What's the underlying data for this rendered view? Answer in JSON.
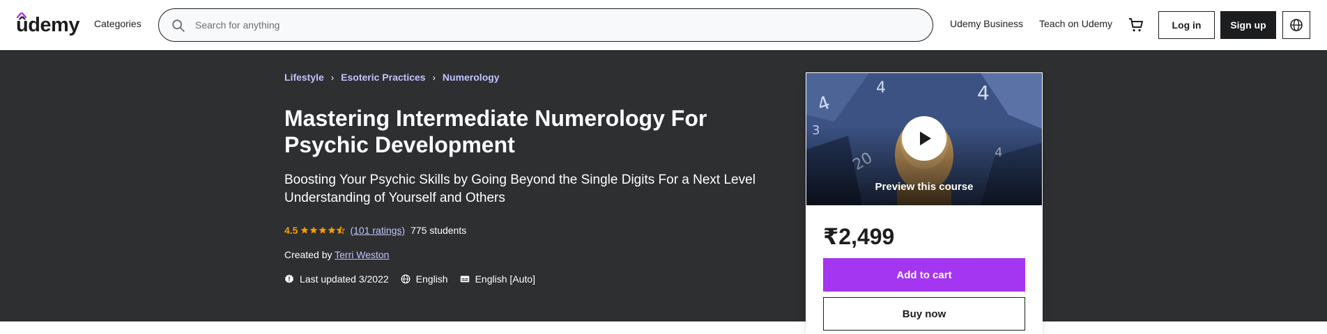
{
  "header": {
    "logo": "ûdemy",
    "categories_label": "Categories",
    "search_placeholder": "Search for anything",
    "business_link": "Udemy Business",
    "teach_link": "Teach on Udemy",
    "login_label": "Log in",
    "signup_label": "Sign up",
    "icons": [
      "search-icon",
      "cart-icon",
      "globe-icon"
    ]
  },
  "breadcrumb": {
    "items": [
      "Lifestyle",
      "Esoteric Practices",
      "Numerology"
    ],
    "separator": "›"
  },
  "course": {
    "title": "Mastering Intermediate Numerology For Psychic Development",
    "subtitle": "Boosting Your Psychic Skills by Going Beyond the Single Digits For a Next Level Understanding of Yourself and Others",
    "rating": "4.5",
    "rating_stars": 4.5,
    "ratings_count": "(101 ratings)",
    "students": "775 students",
    "created_by_label": "Created by",
    "instructor": "Terri Weston",
    "last_updated": "Last updated 3/2022",
    "language": "English",
    "captions": "English [Auto]"
  },
  "sidebar": {
    "preview_label": "Preview this course",
    "price": "₹2,499",
    "add_to_cart_label": "Add to cart",
    "buy_now_label": "Buy now"
  },
  "colors": {
    "banner_bg": "#2d2f31",
    "link": "#c0c4fc",
    "rating": "#f69c08",
    "primary": "#a435f0",
    "text_dark": "#1c1d1f"
  }
}
